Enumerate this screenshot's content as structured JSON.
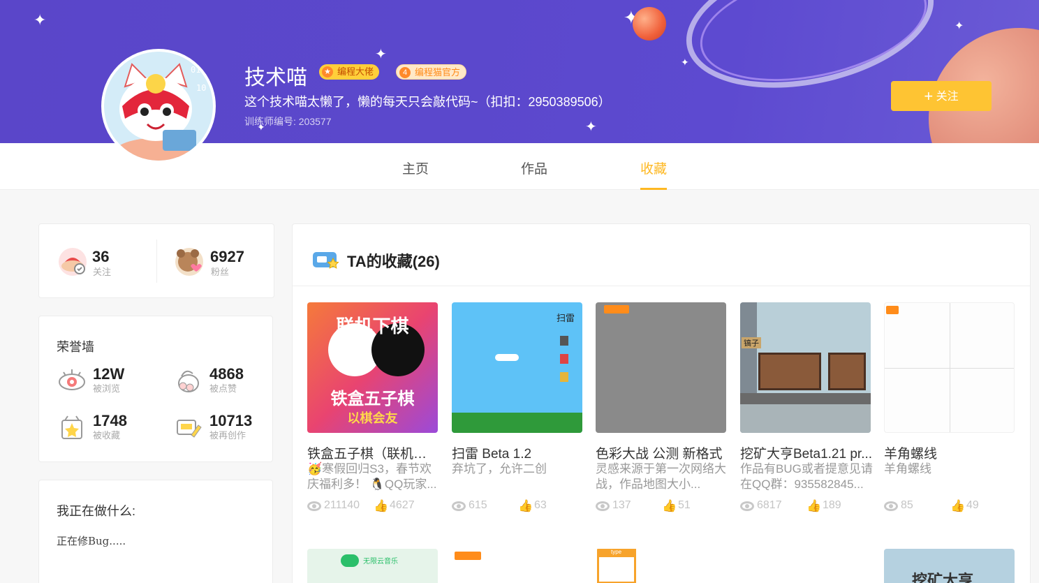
{
  "profile": {
    "name": "技术喵",
    "badge_primary": "编程大佬",
    "badge_secondary": "编程猫官方",
    "bio": "这个技术喵太懒了，懒的每天只会敲代码~（扣扣：2950389506）",
    "trainer_id": "训练师编号: 203577",
    "follow_button": "关注"
  },
  "tabs": [
    {
      "label": "主页",
      "active": false
    },
    {
      "label": "作品",
      "active": false
    },
    {
      "label": "收藏",
      "active": true
    }
  ],
  "social": {
    "following_count": "36",
    "following_label": "关注",
    "fans_count": "6927",
    "fans_label": "粉丝"
  },
  "honor": {
    "title": "荣誉墙",
    "items": [
      {
        "value": "12W",
        "label": "被浏览",
        "icon": "eye-icon"
      },
      {
        "value": "4868",
        "label": "被点赞",
        "icon": "paw-icon"
      },
      {
        "value": "1748",
        "label": "被收藏",
        "icon": "star-box-icon"
      },
      {
        "value": "10713",
        "label": "被再创作",
        "icon": "pencil-icon"
      }
    ]
  },
  "doing": {
    "title": "我正在做什么:",
    "text": "正在修Bug....."
  },
  "favorites": {
    "title": "TA的收藏(26)",
    "works": [
      {
        "title": "铁盒五子棋（联机下棋...",
        "desc": "🥳寒假回归S3，春节欢庆福利多！ 🐧QQ玩家...",
        "views": "211140",
        "likes": "4627",
        "thumb_text": [
          "联机下棋",
          "铁盒五子棋",
          "以棋会友"
        ]
      },
      {
        "title": "扫雷 Beta 1.2",
        "desc": "弃坑了，允许二创",
        "views": "615",
        "likes": "63",
        "thumb_text": [
          "扫雷"
        ]
      },
      {
        "title": "色彩大战 公测 新格式",
        "desc": "灵感来源于第一次网络大战，作品地图大小...",
        "views": "137",
        "likes": "51",
        "thumb_text": []
      },
      {
        "title": "挖矿大亨Beta1.21 pr...",
        "desc": "作品有BUG或者提意见请在QQ群：935582845...",
        "views": "6817",
        "likes": "189",
        "thumb_text": [
          "镐子"
        ]
      },
      {
        "title": "羊角螺线",
        "desc": "羊角螺线",
        "views": "85",
        "likes": "49",
        "thumb_text": []
      }
    ],
    "second_row": [
      {
        "thumb_text": "无限云音乐"
      },
      {
        "thumb_text": ""
      },
      {
        "thumb_text": "type"
      },
      {
        "thumb_text": ""
      },
      {
        "thumb_text": "挖矿大亨"
      }
    ]
  },
  "colors": {
    "banner": "#5a46c9",
    "accent": "#feb822",
    "follow_button": "#fec433"
  }
}
